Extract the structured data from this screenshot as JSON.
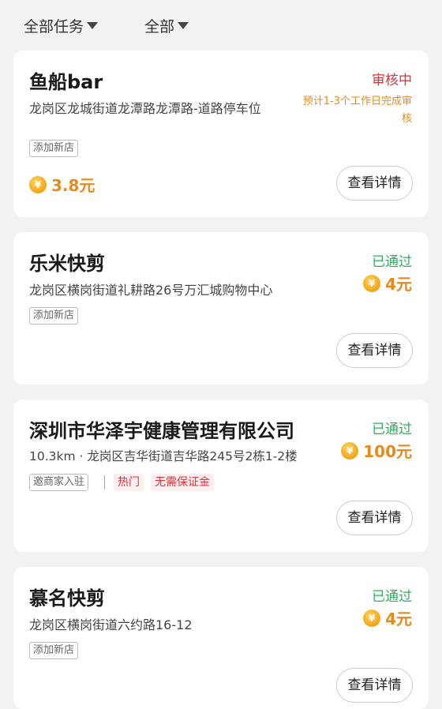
{
  "filters": {
    "task_filter": "全部任务",
    "status_filter": "全部"
  },
  "tasks": [
    {
      "title": "鱼船bar",
      "address": "龙岗区龙城街道龙潭路龙潭路-道路停车位",
      "status": "审核中",
      "status_note": "预计1-3个工作日完成审核",
      "tag": "添加新店",
      "reward": "3.8元",
      "button": "查看详情"
    },
    {
      "title": "乐米快剪",
      "address": "龙岗区横岗街道礼耕路26号万汇城购物中心",
      "status": "已通过",
      "tag": "添加新店",
      "reward": "4元",
      "button": "查看详情"
    },
    {
      "title": "深圳市华泽宇健康管理有限公司",
      "address": "10.3km · 龙岗区吉华街道吉华路245号2栋1-2楼",
      "status": "已通过",
      "tag": "邀商家入驻",
      "hot_tags": [
        "热门",
        "无需保证金"
      ],
      "reward": "100元",
      "button": "查看详情"
    },
    {
      "title": "慕名快剪",
      "address": "龙岗区横岗街道六约路16-12",
      "status": "已通过",
      "tag": "添加新店",
      "reward": "4元",
      "button": "查看详情"
    }
  ],
  "coin_symbol": "¥",
  "colors": {
    "review": "#d8333e",
    "passed": "#2fad5e",
    "reward": "#e8891c"
  }
}
